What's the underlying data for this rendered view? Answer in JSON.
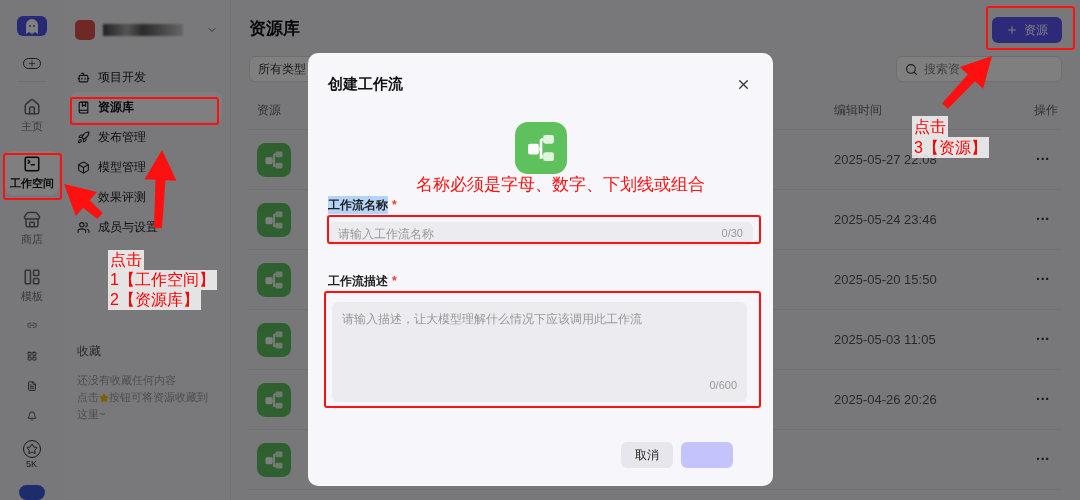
{
  "rail": {
    "items": [
      {
        "label": "主页",
        "selected": false
      },
      {
        "label": "工作空间",
        "selected": true
      },
      {
        "label": "商店",
        "selected": false
      },
      {
        "label": "模板",
        "selected": false
      }
    ],
    "badge": "5K"
  },
  "workspace": {
    "menu": [
      {
        "label": "项目开发",
        "selected": false
      },
      {
        "label": "资源库",
        "selected": true
      },
      {
        "label": "发布管理",
        "selected": false
      },
      {
        "label": "模型管理",
        "selected": false
      },
      {
        "label": "效果评测",
        "selected": false
      },
      {
        "label": "成员与设置",
        "selected": false
      }
    ],
    "favorites": {
      "title": "收藏",
      "empty": "还没有收藏任何内容",
      "hint_before": "点击",
      "hint_after": "按钮可将资源收藏到",
      "hint_end": "这里~"
    }
  },
  "main": {
    "title": "资源库",
    "filter": "所有类型",
    "search_placeholder": "搜索资",
    "add_button": "资源",
    "columns": [
      "资源",
      "编辑时间",
      "操作"
    ],
    "rows": [
      {
        "time": "2025-05-27 22:08",
        "actions": "···"
      },
      {
        "time": "2025-05-24 23:46",
        "actions": "···"
      },
      {
        "time": "2025-05-20 15:50",
        "actions": "···"
      },
      {
        "time": "2025-05-03 11:05",
        "actions": "···"
      },
      {
        "time": "2025-04-26 20:26",
        "actions": "···"
      },
      {
        "actions": "···"
      }
    ]
  },
  "dialog": {
    "title": "创建工作流",
    "name_label": "工作流名称",
    "name_label_highlighted": true,
    "required_mark": "*",
    "name_placeholder": "请输入工作流名称",
    "name_counter": "0/30",
    "desc_label": "工作流描述",
    "desc_placeholder": "请输入描述，让大模型理解什么情况下应该调用此工作流",
    "desc_counter": "0/600",
    "cancel": "取消"
  },
  "annotations": {
    "left": [
      "点击",
      "1【工作空间】",
      "2【资源库】"
    ],
    "middle": "名称必须是字母、数字、下划线或组合",
    "right": [
      "点击",
      "3【资源】"
    ]
  }
}
